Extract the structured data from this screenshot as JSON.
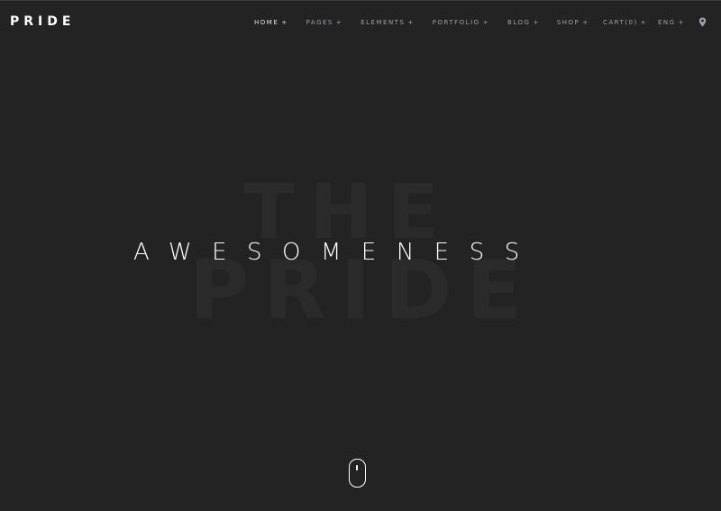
{
  "header": {
    "logo": "PRIDE",
    "nav": [
      {
        "label": "HOME",
        "suffix": "+"
      },
      {
        "label": "PAGES",
        "suffix": "+"
      },
      {
        "label": "ELEMENTS",
        "suffix": "+"
      },
      {
        "label": "PORTFOLIO",
        "suffix": "+"
      },
      {
        "label": "BLOG",
        "suffix": "+"
      },
      {
        "label": "SHOP",
        "suffix": "+"
      }
    ],
    "cart": {
      "label": "CART(0)",
      "suffix": "+"
    },
    "lang": {
      "label": "ENG",
      "suffix": "+"
    },
    "location_icon": "map-pin-icon"
  },
  "hero": {
    "bg_line1": "THE",
    "bg_line2": "PRIDE",
    "title": "AWESOMENESS",
    "scroll_icon": "mouse-scroll-icon"
  },
  "colors": {
    "background": "#232323",
    "nav_text": "#9aa3a8",
    "nav_active": "#dfe4e7",
    "hero_text": "#ffffff",
    "watermark": "#2a2a2a"
  }
}
